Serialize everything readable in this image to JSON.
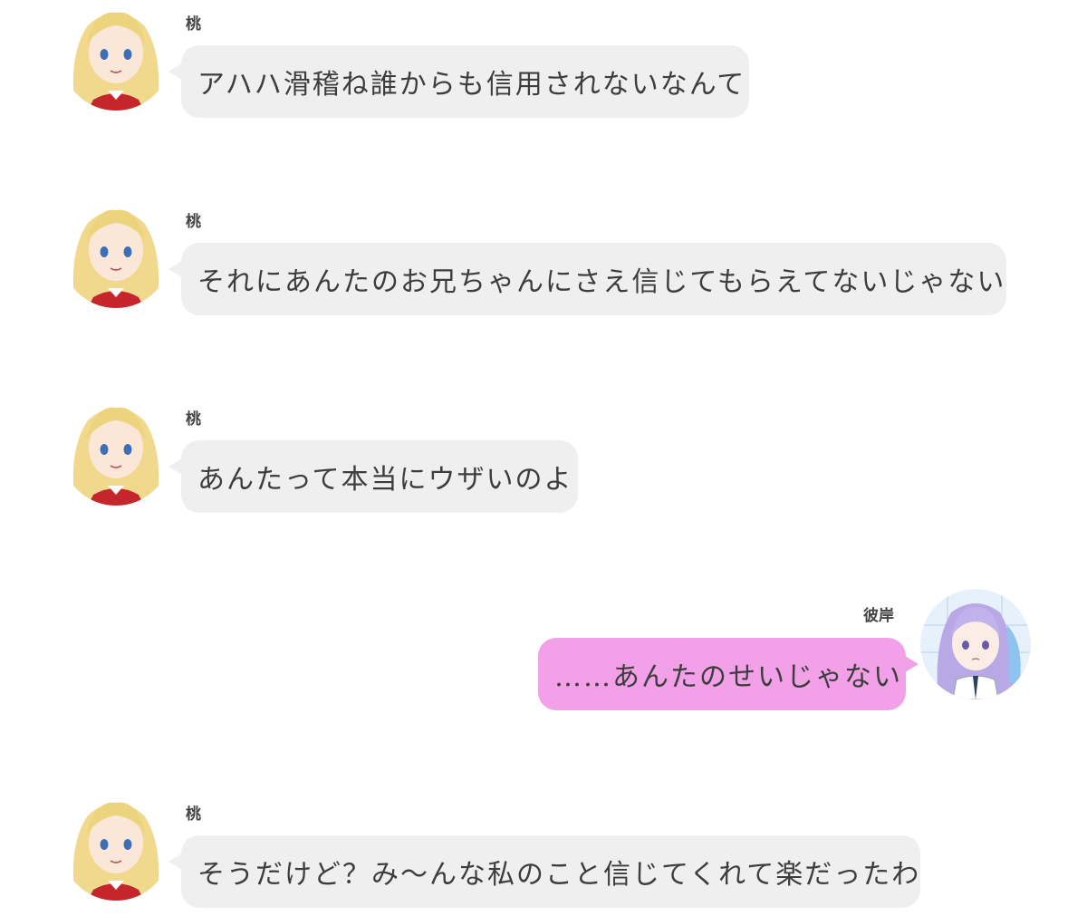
{
  "messages": [
    {
      "side": "left",
      "sender": "桃",
      "text": "アハハ滑稽ね誰からも信用されないなんて",
      "avatar": "blonde-girl-avatar"
    },
    {
      "side": "left",
      "sender": "桃",
      "text": "それにあんたのお兄ちゃんにさえ信じてもらえてないじゃない",
      "avatar": "blonde-girl-avatar"
    },
    {
      "side": "left",
      "sender": "桃",
      "text": "あんたって本当にウザいのよ",
      "avatar": "blonde-girl-avatar"
    },
    {
      "side": "right",
      "sender": "彼岸",
      "text": "……あんたのせいじゃない",
      "avatar": "purple-hair-girl-avatar"
    },
    {
      "side": "left",
      "sender": "桃",
      "text": "そうだけど？み〜んな私のこと信じてくれて楽だったわ",
      "avatar": "blonde-girl-avatar"
    }
  ],
  "colors": {
    "incoming_bubble": "#efefef",
    "outgoing_bubble": "#f2a0e8",
    "text": "#3d3d3d"
  }
}
